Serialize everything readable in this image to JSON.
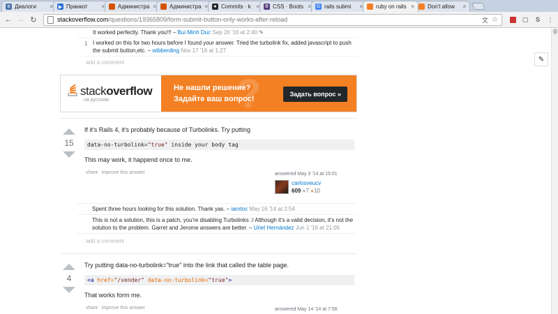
{
  "browser": {
    "tabs": [
      {
        "title": "Диалоги",
        "color": "#4a76a8",
        "glyph": "в"
      },
      {
        "title": "Пранкот",
        "color": "#2b6fd1",
        "glyph": "▶"
      },
      {
        "title": "Администра",
        "color": "#d35400",
        "glyph": ""
      },
      {
        "title": "Администра",
        "color": "#d35400",
        "glyph": ""
      },
      {
        "title": "Commits · k",
        "color": "#24292e",
        "glyph": "●"
      },
      {
        "title": "CSS · Boots",
        "color": "#563d7c",
        "glyph": "B"
      },
      {
        "title": "rails submi",
        "color": "#4285f4",
        "glyph": "G"
      },
      {
        "title": "ruby on rails",
        "color": "#f48024",
        "glyph": ""
      },
      {
        "title": "Don't allow",
        "color": "#f48024",
        "glyph": ""
      }
    ],
    "url_domain": "stackoverflow.com",
    "url_path": "/questions/19365809/form-submit-button-only-works-after-reload"
  },
  "comments_top": [
    {
      "score": "",
      "text": "It worked perfectly. Thank you!!! – ",
      "user": "Bui Minh Duc",
      "date": "Sep 26 '16 at 2:40",
      "edit": "✎"
    },
    {
      "score": "1",
      "text": "I worked on this for two hours before I found your answer. Tried the turbolink fix, added javascript to push the submit button,etc. – ",
      "user": "wibberding",
      "date": "Nov 17 '16 at 1:27"
    }
  ],
  "add_comment": "add a comment",
  "banner": {
    "logo_a": "stack",
    "logo_b": "overflow",
    "logo_sub": "на русском",
    "line1": "Не нашли решение?",
    "line2": "Задайте ваш вопрос!",
    "button": "Задать вопрос »"
  },
  "answer1": {
    "votes": "15",
    "text1": "If it's Rails 4, it's probably because of Turbolinks. Try putting",
    "code_a": "data-no-turbolink=",
    "code_str": "\"true\"",
    "code_b": " inside your body tag",
    "text2": "This may work, it happend once to me.",
    "share": "share",
    "improve": "improve this answer",
    "answered": "answered May 3 '14 at 15:01",
    "user": "carlosveucv",
    "rep": "609",
    "silver": "7",
    "bronze": "10",
    "comments": [
      {
        "text": "Spent three hours looking for this solution. Thank yas. – ",
        "user": "iamtoc",
        "date": "May 16 '14 at 2:54"
      },
      {
        "text": "This is not a solution, this is a patch, you're disabling Turbolinks :/ Although it's a valid decision, it's not the solution to the problem. Garret and Jerome answers are better. – ",
        "user": "Uriel Hernández",
        "date": "Jun 1 '16 at 21:05"
      }
    ]
  },
  "answer2": {
    "votes": "4",
    "text1": "Try putting data-no-turbolink=\"true\" into the link that called the table page.",
    "code_lt": "<a ",
    "code_attr1": "href=",
    "code_val1": "\"/vender\"",
    "code_attr2": " data-no-turbolink=",
    "code_val2": "\"true\"",
    "code_gt": ">",
    "text2": "That works form me.",
    "share": "share",
    "improve": "improve this answer",
    "answered": "answered May 14 '14 at 7:58"
  }
}
